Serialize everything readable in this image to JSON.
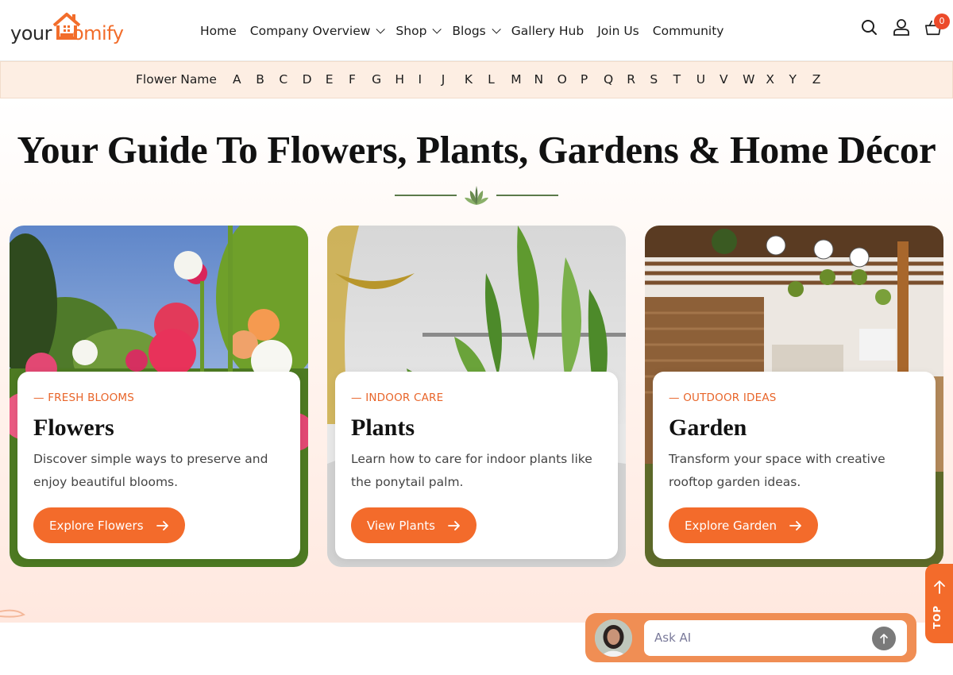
{
  "brand": {
    "logo_dark": "your",
    "logo_orange": "omify"
  },
  "nav": [
    {
      "label": "Home",
      "has_dropdown": false
    },
    {
      "label": "Company Overview",
      "has_dropdown": true
    },
    {
      "label": "Shop",
      "has_dropdown": true
    },
    {
      "label": "Blogs",
      "has_dropdown": true
    },
    {
      "label": "Gallery Hub",
      "has_dropdown": false
    },
    {
      "label": "Join Us",
      "has_dropdown": false
    },
    {
      "label": "Community",
      "has_dropdown": false
    }
  ],
  "header_icons": [
    "search-icon",
    "user-icon",
    "cart-icon"
  ],
  "cart_count": "0",
  "alphabet": {
    "label": "Flower Name",
    "letters": [
      "A",
      "B",
      "C",
      "D",
      "E",
      "F",
      "G",
      "H",
      "I",
      "J",
      "K",
      "L",
      "M",
      "N",
      "O",
      "P",
      "Q",
      "R",
      "S",
      "T",
      "U",
      "V",
      "W",
      "X",
      "Y",
      "Z"
    ]
  },
  "hero": {
    "title": "Your Guide To Flowers, Plants, Gardens & Home Décor"
  },
  "cards": [
    {
      "tag": "— FRESH BLOOMS",
      "title": "Flowers",
      "description": "Discover simple ways to preserve and enjoy beautiful blooms.",
      "button": "Explore Flowers"
    },
    {
      "tag": "— INDOOR CARE",
      "title": "Plants",
      "description": "Learn how to care for indoor plants like the ponytail palm.",
      "button": "View Plants"
    },
    {
      "tag": "— OUTDOOR IDEAS",
      "title": "Garden",
      "description": "Transform your space with creative rooftop garden ideas.",
      "button": "Explore Garden"
    }
  ],
  "top_button": "TOP",
  "ask_ai": {
    "placeholder": "Ask AI"
  },
  "colors": {
    "accent": "#f36b2b",
    "alpha_bar_bg": "#fdeee3",
    "leaf": "#5b7a4a"
  }
}
